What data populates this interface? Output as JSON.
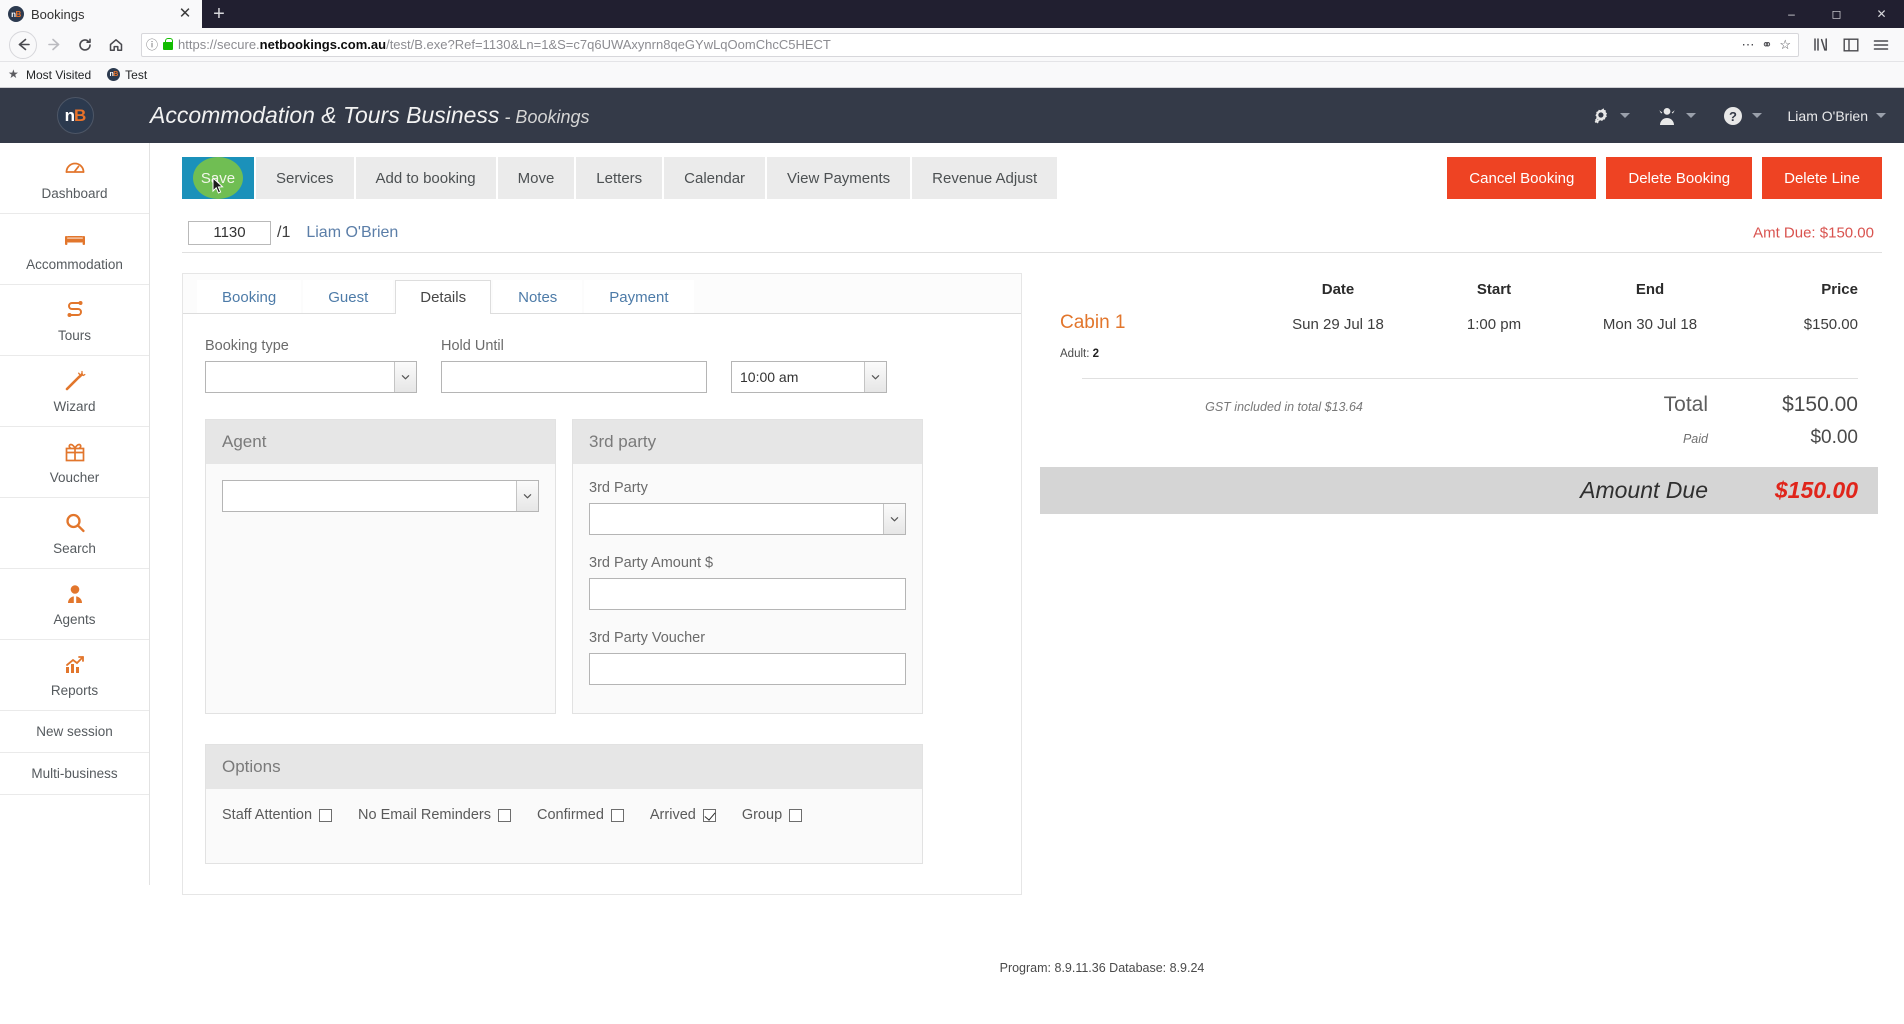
{
  "browser": {
    "tab": {
      "title": "Bookings",
      "favicon": "nb-favicon",
      "close_icon": "close-icon"
    },
    "new_tab_icon": "plus-icon",
    "window_controls": [
      "minimize-icon",
      "maximize-icon",
      "close-icon"
    ],
    "nav": {
      "back_icon": "back-arrow-icon",
      "forward_icon": "forward-arrow-icon",
      "reload_icon": "reload-icon",
      "home_icon": "home-icon"
    },
    "urlbar": {
      "identity_icon": "info-icon",
      "lock_icon": "padlock-icon",
      "url_prefix": "https://secure.",
      "url_domain": "netbookings.com.au",
      "url_suffix": "/test/B.exe?Ref=1130&Ln=1&S=c7q6UWAxynrn8qeGYwLqOomChcC5HECT",
      "page_actions_icon": "ellipsis-icon",
      "pocket_icon": "shield-icon",
      "bookmark_icon": "star-outline-icon"
    },
    "right_controls": [
      "library-icon",
      "sidebar-icon",
      "hamburger-menu-icon"
    ],
    "bookmarks": [
      {
        "label": "Most Visited",
        "icon": "star-icon"
      },
      {
        "label": "Test",
        "icon": "nb-favicon"
      }
    ]
  },
  "header": {
    "logo": "netbookings-logo",
    "title": "Accommodation & Tours Business",
    "subtitle": " - Bookings",
    "items": [
      {
        "name": "settings",
        "icon": "gears-icon",
        "label": ""
      },
      {
        "name": "staff",
        "icon": "user-tie-icon",
        "label": ""
      },
      {
        "name": "help",
        "icon": "question-circle-icon",
        "label": ""
      },
      {
        "name": "account",
        "icon": "",
        "label": "Liam O'Brien"
      }
    ]
  },
  "sidebar": {
    "items": [
      {
        "label": "Dashboard",
        "icon": "gauge-icon"
      },
      {
        "label": "Accommodation",
        "icon": "bed-icon"
      },
      {
        "label": "Tours",
        "icon": "route-icon"
      },
      {
        "label": "Wizard",
        "icon": "magic-wand-icon"
      },
      {
        "label": "Voucher",
        "icon": "gift-icon"
      },
      {
        "label": "Search",
        "icon": "search-icon"
      },
      {
        "label": "Agents",
        "icon": "agent-user-icon"
      },
      {
        "label": "Reports",
        "icon": "chart-up-icon"
      }
    ],
    "plain_items": [
      {
        "label": "New session"
      },
      {
        "label": "Multi-business"
      }
    ]
  },
  "toolbar": {
    "save_label": "Save",
    "buttons": [
      "Services",
      "Add to booking",
      "Move",
      "Letters",
      "Calendar",
      "View Payments",
      "Revenue Adjust"
    ],
    "danger_buttons": [
      "Cancel Booking",
      "Delete Booking",
      "Delete Line"
    ]
  },
  "subbar": {
    "ref_value": "1130",
    "line": "/1",
    "guest_name": "Liam O'Brien",
    "amt_due_label": "Amt Due: $150.00"
  },
  "tabs": [
    {
      "label": "Booking",
      "active": false
    },
    {
      "label": "Guest",
      "active": false
    },
    {
      "label": "Details",
      "active": true
    },
    {
      "label": "Notes",
      "active": false
    },
    {
      "label": "Payment",
      "active": false
    }
  ],
  "details_form": {
    "booking_type_label": "Booking type",
    "booking_type_value": "",
    "hold_until_label": "Hold Until",
    "hold_until_value": "",
    "hold_until_time": "10:00 am"
  },
  "agent_card": {
    "title": "Agent",
    "agent_value": ""
  },
  "third_party_card": {
    "title": "3rd party",
    "party_label": "3rd Party",
    "party_value": "",
    "amount_label": "3rd Party Amount $",
    "amount_value": "",
    "voucher_label": "3rd Party Voucher",
    "voucher_value": ""
  },
  "options_card": {
    "title": "Options",
    "checkboxes": [
      {
        "label": "Staff Attention",
        "checked": false
      },
      {
        "label": "No Email Reminders",
        "checked": false
      },
      {
        "label": "Confirmed",
        "checked": false
      },
      {
        "label": "Arrived",
        "checked": true
      },
      {
        "label": "Group",
        "checked": false
      }
    ]
  },
  "summary": {
    "columns": [
      "",
      "Date",
      "Start",
      "End",
      "Price"
    ],
    "rows": [
      {
        "item": "Cabin 1",
        "date": "Sun 29 Jul 18",
        "start": "1:00 pm",
        "end": "Mon 30 Jul 18",
        "price": "$150.00"
      }
    ],
    "pax_label": "Adult:",
    "pax_value": "2",
    "gst_note": "GST included in total $13.64",
    "total_label": "Total",
    "total_value": "$150.00",
    "paid_label": "Paid",
    "paid_value": "$0.00",
    "amount_due_label": "Amount Due",
    "amount_due_value": "$150.00"
  },
  "footer": {
    "text": "Program: 8.9.11.36 Database: 8.9.24"
  },
  "colors": {
    "header_bg": "#343a48",
    "accent_orange": "#e2762c",
    "save_blue": "#1b91ba",
    "danger_red": "#ee4323",
    "due_red": "#e0251b",
    "link_blue": "#4d7ba8"
  }
}
